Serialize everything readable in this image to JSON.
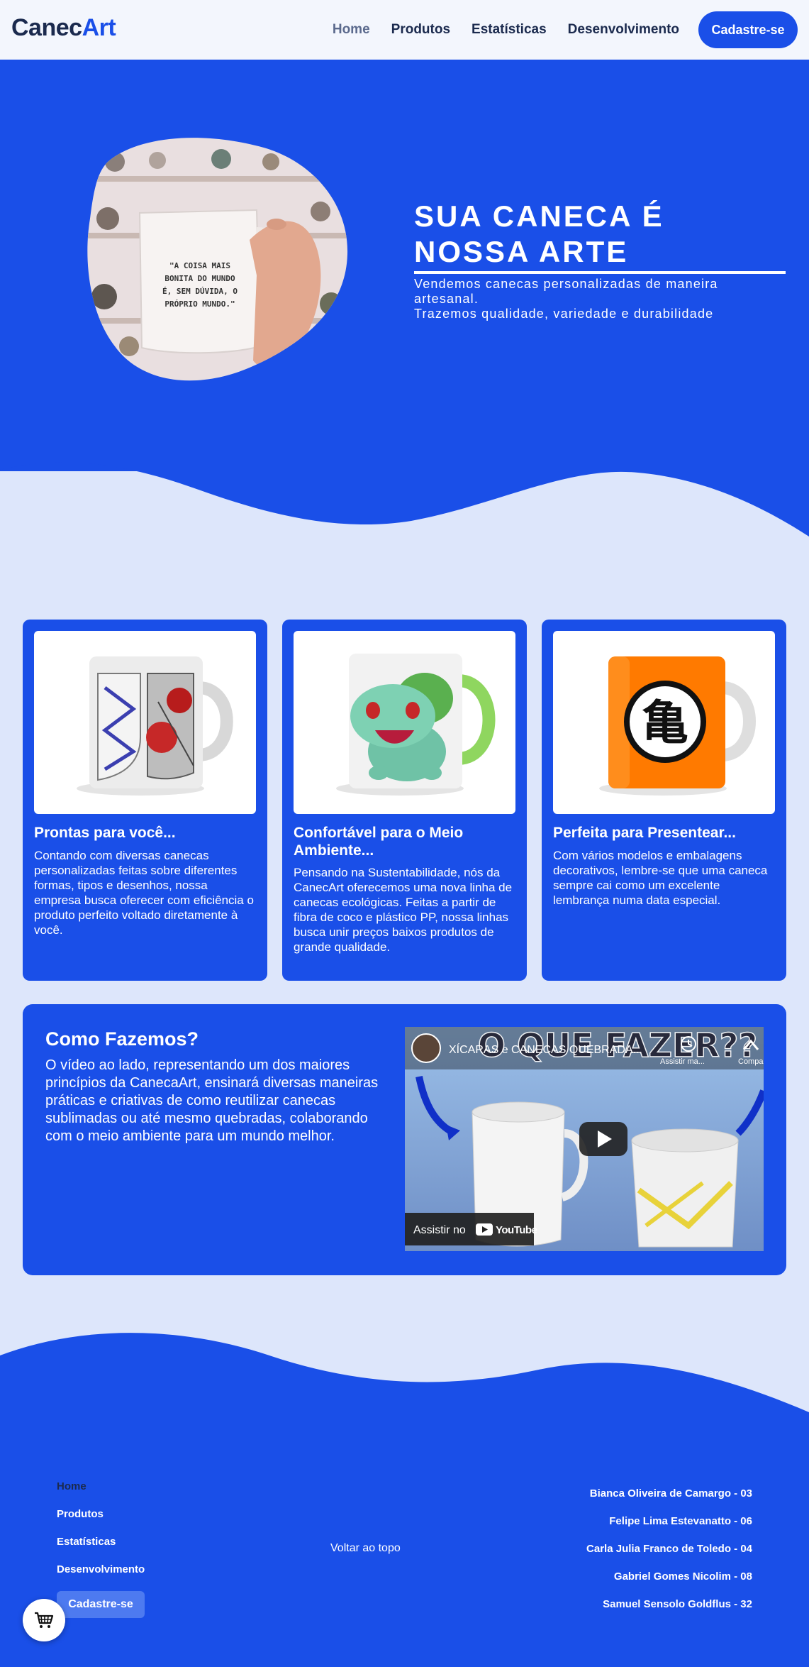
{
  "nav": {
    "logo_part1": "Canec",
    "logo_part2": "Art",
    "links": [
      "Home",
      "Produtos",
      "Estatísticas",
      "Desenvolvimento"
    ],
    "cta": "Cadastre-se"
  },
  "hero": {
    "title": "SUA CANECA É NOSSA ARTE",
    "subtitle_line1": "Vendemos canecas personalizadas de maneira artesanal.",
    "subtitle_line2": "Trazemos qualidade, variedade e durabilidade",
    "mug_text": "\"A COISA MAIS BONITA DO MUNDO É, SEM DÚVIDA, O PRÓPRIO MUNDO.\""
  },
  "cards": [
    {
      "title": "Prontas para você...",
      "text": "Contando com diversas canecas personalizadas feitas sobre diferentes formas, tipos e desenhos, nossa empresa busca oferecer com eficiência o produto perfeito voltado diretamente à você."
    },
    {
      "title": "Confortável para o Meio Ambiente...",
      "text": "Pensando na Sustentabilidade, nós da CanecArt oferecemos uma nova linha de canecas ecológicas. Feitas a partir de fibra de coco e plástico PP, nossa linhas busca unir preços baixos produtos de grande qualidade."
    },
    {
      "title": "Perfeita para Presentear...",
      "text": "Com vários modelos e embalagens decorativos, lembre-se que uma caneca sempre cai como um excelente lembrança numa data especial."
    }
  ],
  "how": {
    "title": "Como Fazemos?",
    "text": "O vídeo ao lado, representando um dos maiores princípios da CanecaArt, ensinará diversas maneiras práticas e criativas de como reutilizar canecas sublimadas ou até mesmo quebradas, colaborando com o meio ambiente para um mundo melhor.",
    "video_title": "XÍCARAS e CANECAS QUEBRADA...",
    "video_overlay": "O QUE FAZER??",
    "video_watch_later": "Assistir ma...",
    "video_share": "Compar...",
    "video_watch_on": "Assistir no",
    "video_platform": "YouTube",
    "kanji": "亀"
  },
  "footer": {
    "links": [
      "Home",
      "Produtos",
      "Estatísticas",
      "Desenvolvimento"
    ],
    "cta": "Cadastre-se",
    "back_to_top": "Voltar ao topo",
    "names": [
      "Bianca Oliveira de Camargo - 03",
      "Felipe Lima Estevanatto - 06",
      "Carla Julia Franco de Toledo - 04",
      "Gabriel Gomes Nicolim - 08",
      "Samuel Sensolo Goldflus - 32"
    ]
  },
  "colors": {
    "primary": "#1a4fe8",
    "background": "#dde6fb",
    "nav_bg": "#f3f6fd",
    "dark_text": "#1b2a4e"
  },
  "icons": [
    "cart-icon",
    "play-icon",
    "youtube-icon",
    "clock-icon",
    "share-icon"
  ]
}
